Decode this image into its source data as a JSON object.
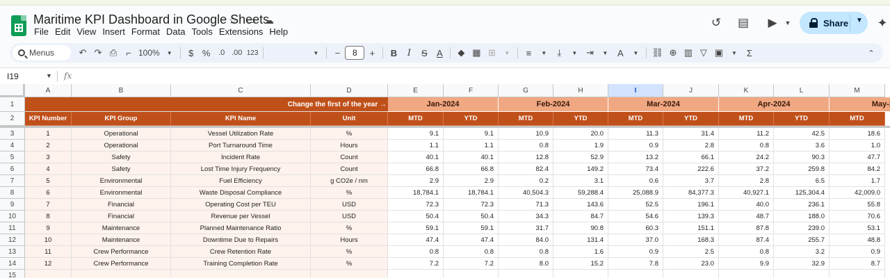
{
  "app": {
    "doc_title": "Maritime KPI Dashboard in Google Sheets",
    "menu": [
      "File",
      "Edit",
      "View",
      "Insert",
      "Format",
      "Data",
      "Tools",
      "Extensions",
      "Help"
    ],
    "share_label": "Share"
  },
  "toolbar": {
    "menus_label": "Menus",
    "zoom": "100%",
    "currency": "$",
    "percent": "%",
    "dec_decrease": ".0",
    "dec_increase": ".00",
    "number_format": "123",
    "font_size": "8",
    "minus": "−",
    "plus": "+"
  },
  "formula_bar": {
    "name_box": "I19",
    "fx": "fx"
  },
  "columns": [
    "A",
    "B",
    "C",
    "D",
    "E",
    "F",
    "G",
    "H",
    "I",
    "J",
    "K",
    "L",
    "M"
  ],
  "selected_column": "I",
  "row_numbers": [
    "1",
    "2",
    "3",
    "4",
    "5",
    "6",
    "7",
    "8",
    "9",
    "10",
    "11",
    "12",
    "13",
    "14",
    "15"
  ],
  "sheet": {
    "note": "Change the first of the year →",
    "months": [
      "Jan-2024",
      "Feb-2024",
      "Mar-2024",
      "Apr-2024",
      "May-20"
    ],
    "headers": [
      "KPI Number",
      "KPI Group",
      "KPI Name",
      "Unit"
    ],
    "subheaders": [
      "MTD",
      "YTD",
      "MTD",
      "YTD",
      "MTD",
      "YTD",
      "MTD",
      "YTD",
      "MTD"
    ],
    "rows": [
      {
        "num": "1",
        "group": "Operational",
        "name": "Vessel Utilization Rate",
        "unit": "%",
        "values": [
          "9.1",
          "9.1",
          "10.9",
          "20.0",
          "11.3",
          "31.4",
          "11.2",
          "42.5",
          "18.6"
        ]
      },
      {
        "num": "2",
        "group": "Operational",
        "name": "Port Turnaround Time",
        "unit": "Hours",
        "values": [
          "1.1",
          "1.1",
          "0.8",
          "1.9",
          "0.9",
          "2.8",
          "0.8",
          "3.6",
          "1.0"
        ]
      },
      {
        "num": "3",
        "group": "Safety",
        "name": "Incident Rate",
        "unit": "Count",
        "values": [
          "40.1",
          "40.1",
          "12.8",
          "52.9",
          "13.2",
          "66.1",
          "24.2",
          "90.3",
          "47.7"
        ]
      },
      {
        "num": "4",
        "group": "Safety",
        "name": "Lost Time Injury Frequency",
        "unit": "Count",
        "values": [
          "66.8",
          "66.8",
          "82.4",
          "149.2",
          "73.4",
          "222.6",
          "37.2",
          "259.8",
          "84.2"
        ]
      },
      {
        "num": "5",
        "group": "Environmental",
        "name": "Fuel Efficiency",
        "unit": "g CO2e / nm",
        "values": [
          "2.9",
          "2.9",
          "0.2",
          "3.1",
          "0.6",
          "3.7",
          "2.8",
          "6.5",
          "1.7"
        ]
      },
      {
        "num": "6",
        "group": "Environmental",
        "name": "Waste Disposal Compliance",
        "unit": "%",
        "values": [
          "18,784.1",
          "18,784.1",
          "40,504.3",
          "59,288.4",
          "25,088.9",
          "84,377.3",
          "40,927.1",
          "125,304.4",
          "42,009.0"
        ]
      },
      {
        "num": "7",
        "group": "Financial",
        "name": "Operating Cost per TEU",
        "unit": "USD",
        "values": [
          "72.3",
          "72.3",
          "71.3",
          "143.6",
          "52.5",
          "196.1",
          "40.0",
          "236.1",
          "55.8"
        ]
      },
      {
        "num": "8",
        "group": "Financial",
        "name": "Revenue per Vessel",
        "unit": "USD",
        "values": [
          "50.4",
          "50.4",
          "34.3",
          "84.7",
          "54.6",
          "139.3",
          "48.7",
          "188.0",
          "70.6"
        ]
      },
      {
        "num": "9",
        "group": "Maintenance",
        "name": "Planned Maintenance Ratio",
        "unit": "%",
        "values": [
          "59.1",
          "59.1",
          "31.7",
          "90.8",
          "60.3",
          "151.1",
          "87.8",
          "239.0",
          "53.1"
        ]
      },
      {
        "num": "10",
        "group": "Maintenance",
        "name": "Downtime Due to Repairs",
        "unit": "Hours",
        "values": [
          "47.4",
          "47.4",
          "84.0",
          "131.4",
          "37.0",
          "168.3",
          "87.4",
          "255.7",
          "48.8"
        ]
      },
      {
        "num": "11",
        "group": "Crew Performance",
        "name": "Crew Retention Rate",
        "unit": "%",
        "values": [
          "0.8",
          "0.8",
          "0.8",
          "1.6",
          "0.9",
          "2.5",
          "0.8",
          "3.2",
          "0.9"
        ]
      },
      {
        "num": "12",
        "group": "Crew Performance",
        "name": "Training Completion Rate",
        "unit": "%",
        "values": [
          "7.2",
          "7.2",
          "8.0",
          "15.2",
          "7.8",
          "23.0",
          "9.9",
          "32.9",
          "8.7"
        ]
      }
    ]
  }
}
